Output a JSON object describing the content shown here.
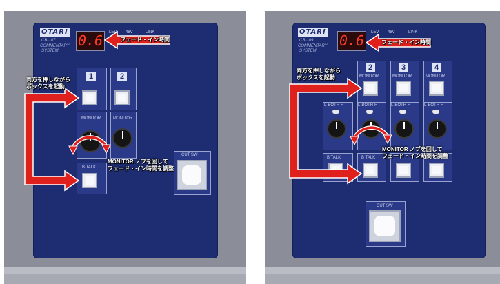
{
  "panels": [
    {
      "brand": "OTARI",
      "model": "CB-187",
      "subtitle_1": "COMMENTARY",
      "subtitle_2": "SYSTEM",
      "display": "0.6",
      "top_labels": [
        "LEV",
        "48V",
        "LINK"
      ],
      "channels": [
        "1",
        "2"
      ],
      "monitor_label": "MONITOR",
      "talk_label": "B TALK",
      "cut_label": "CUT SW",
      "callout_fade": "フェード・イン時間",
      "callout_start_1": "両方を押しながら",
      "callout_start_2": "ボックスを起動",
      "callout_knob_1": "MONITOR ノブを回して",
      "callout_knob_2": "フェード・イン時間を調整"
    },
    {
      "brand": "OTARI",
      "model": "CB-189",
      "subtitle_1": "COMMENTARY",
      "subtitle_2": "SYSTEM",
      "display": "0.6",
      "top_labels": [
        "LEV",
        "48V",
        "LINK"
      ],
      "channels": [
        "2",
        "3",
        "4"
      ],
      "monitor_label": "MONITOR",
      "switch_label": "L-BOTH-R",
      "talk_label": "B TALK",
      "cut_label": "CUT SW",
      "callout_fade": "フェード・イン時間",
      "callout_start_1": "両方を押しながら",
      "callout_start_2": "ボックスを起動",
      "callout_knob_1": "MONITOR ノブを回して",
      "callout_knob_2": "フェード・イン時間を調整"
    }
  ],
  "colors": {
    "panel_blue": "#1e2d72",
    "arrow_red": "#e0201c",
    "display_red": "#ff3a2a"
  }
}
